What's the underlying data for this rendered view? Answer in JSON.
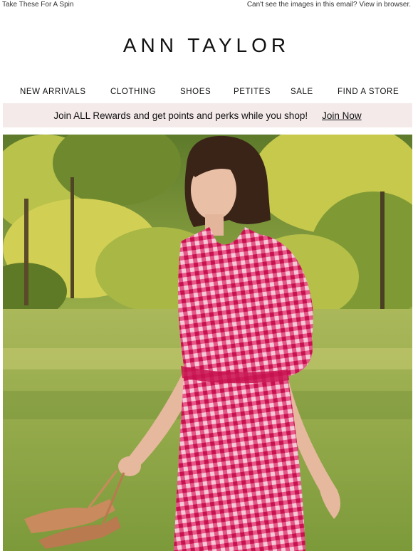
{
  "preheader": {
    "left_link": "Take These For A Spin",
    "right_link": "Can't see the images in this email? View in browser."
  },
  "brand": {
    "logo_text": "ANN TAYLOR"
  },
  "nav": {
    "items": [
      {
        "label": "NEW ARRIVALS"
      },
      {
        "label": "CLOTHING"
      },
      {
        "label": "SHOES"
      },
      {
        "label": "PETITES"
      },
      {
        "label": "SALE"
      },
      {
        "label": "FIND A STORE"
      }
    ]
  },
  "rewards_banner": {
    "message": "Join ALL Rewards and get points and perks while you shop!",
    "cta": "Join Now"
  },
  "hero": {
    "alt_subject": "woman-in-pink-gingham-dress-holding-sandals"
  },
  "colors": {
    "banner_bg": "#f4eaea",
    "dress_pink": "#e0336f",
    "grass": "#8fa446",
    "foliage": "#c5c94a"
  }
}
